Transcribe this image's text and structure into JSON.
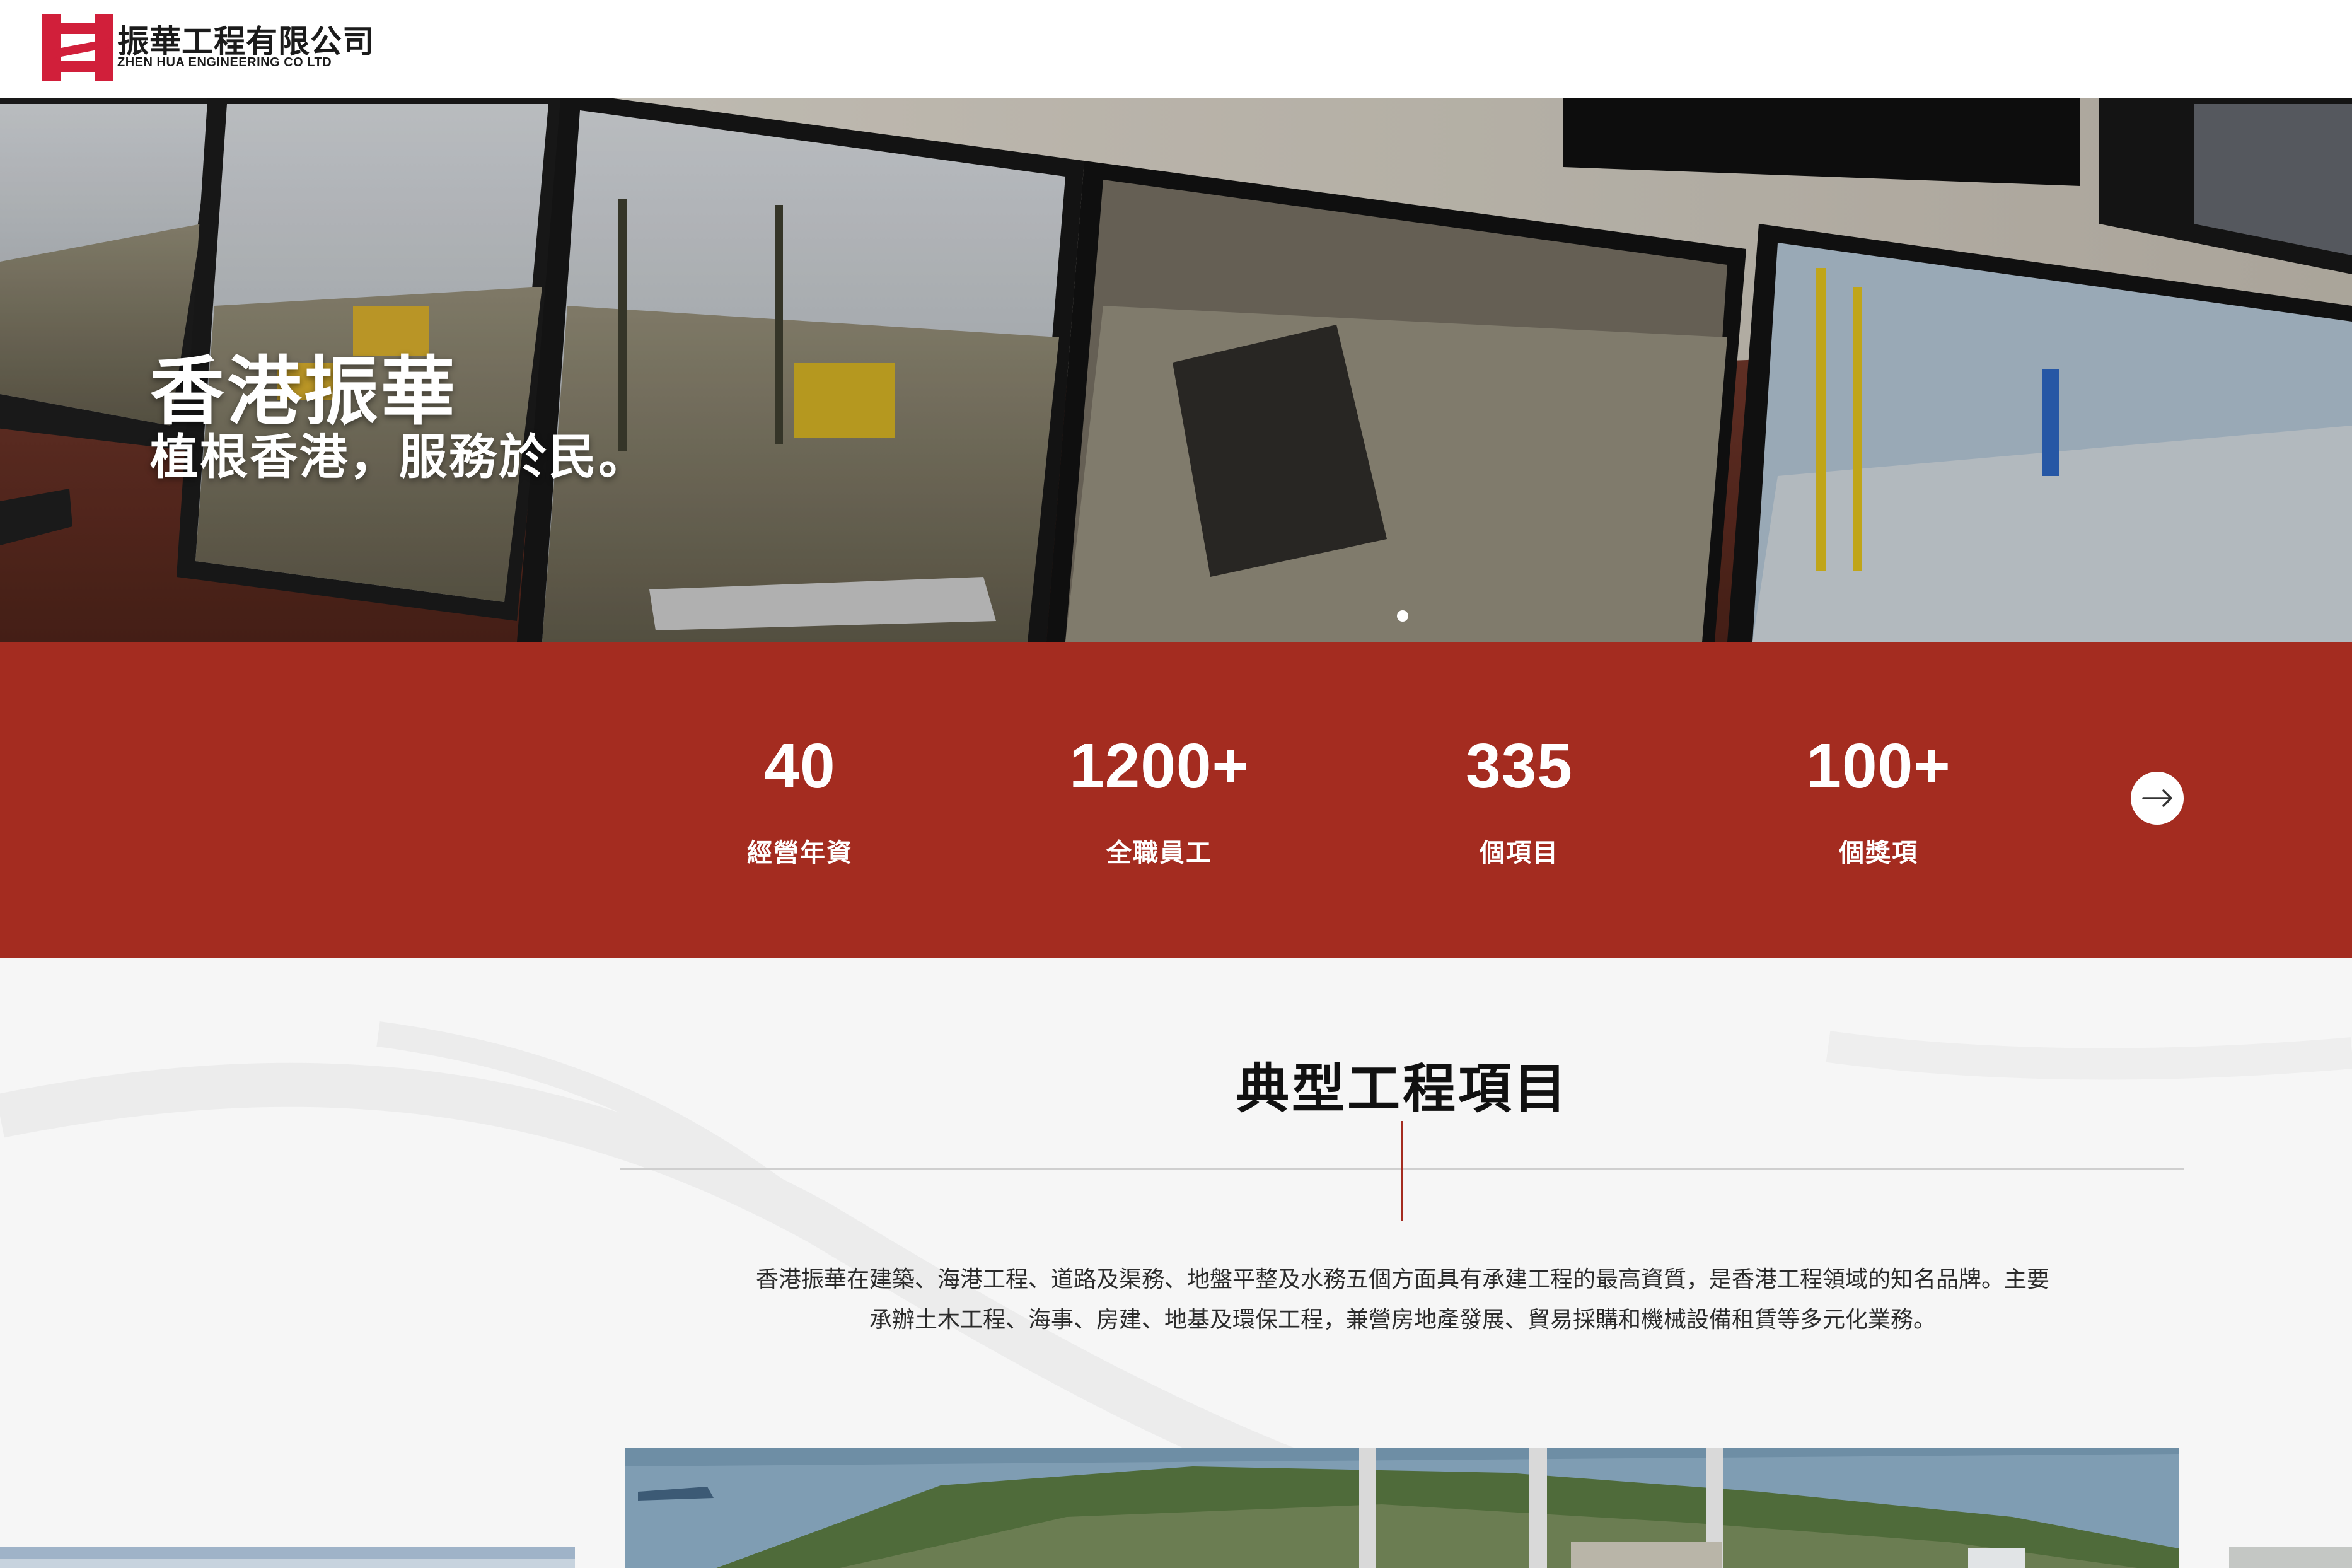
{
  "header": {
    "logo_cn": "振華工程有限公司",
    "logo_en": "ZHEN HUA ENGINEERING CO LTD",
    "logo_icon": "zhenhua-logo-icon"
  },
  "hero": {
    "title": "香港振華",
    "subtitle": "植根香港，服務於民。",
    "slide_indicator_icon": "slide-dot-icon"
  },
  "stats": {
    "items": [
      {
        "value": "40",
        "label": "經營年資"
      },
      {
        "value": "1200+",
        "label": "全職員工"
      },
      {
        "value": "335",
        "label": "個項目"
      },
      {
        "value": "100+",
        "label": "個獎項"
      }
    ],
    "next_icon": "arrow-right-icon"
  },
  "projects": {
    "title": "典型工程項目",
    "description_line1": "香港振華在建築、海港工程、道路及渠務、地盤平整及水務五個方面具有承建工程的最高資質，是香港工程領域的知名品牌。主要",
    "description_line2": "承辦土木工程、海事、房建、地基及環保工程，兼營房地產發展、貿易採購和機械設備租賃等多元化業務。"
  },
  "colors": {
    "brand_red": "#a42c20",
    "logo_red": "#d11f3a",
    "text_dark": "#111111",
    "section_bg": "#f6f6f6"
  }
}
